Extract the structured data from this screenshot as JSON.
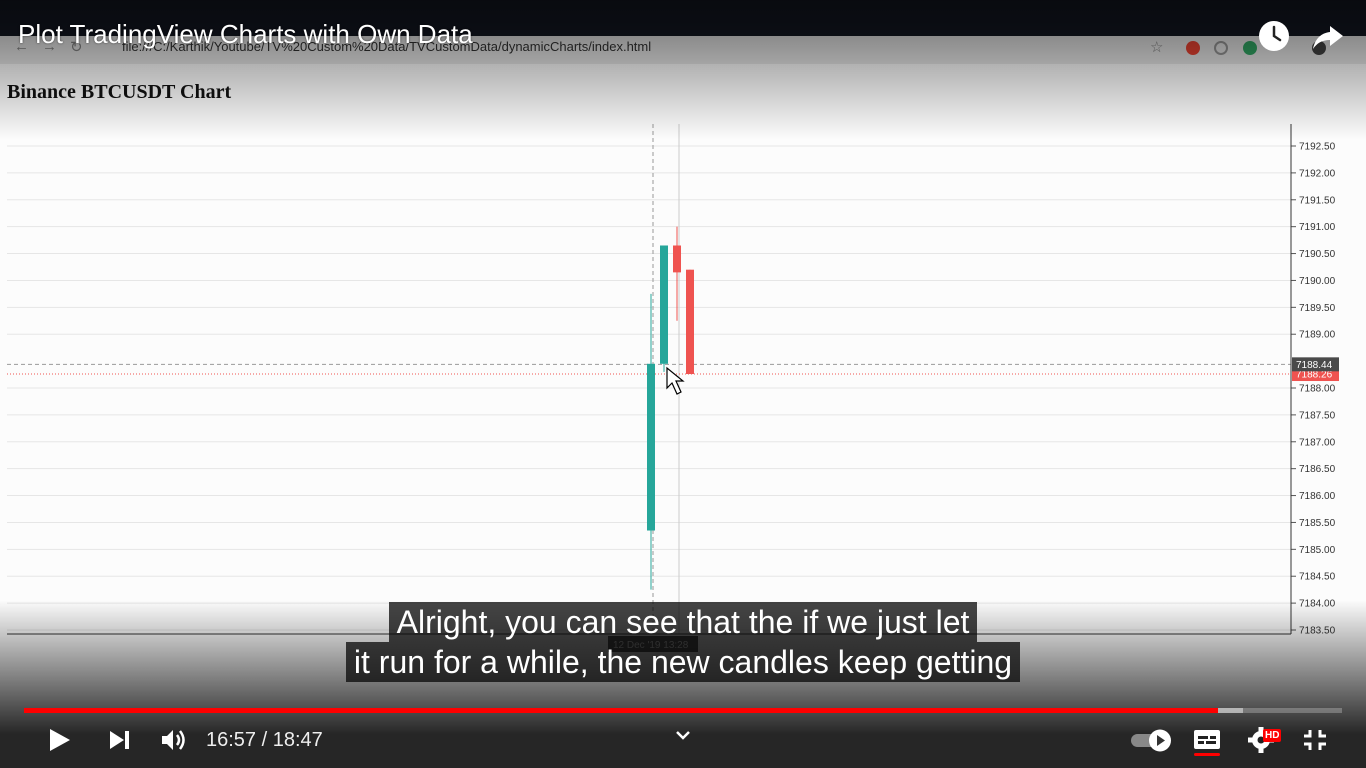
{
  "video": {
    "title": "Plot TradingView Charts with Own Data",
    "captions": [
      "Alright, you can see that the if we just let",
      "it run for a while, the new candles keep getting"
    ],
    "time_current": "16:57",
    "time_separator": " / ",
    "time_total": "18:47",
    "progress": 0.906,
    "buffered": 0.925,
    "accent_color": "#ff0000",
    "icons": {
      "watch_later": "clock-icon",
      "share": "share-arrow-icon",
      "play": "play-icon",
      "next": "next-icon",
      "volume": "volume-icon",
      "expand": "chevron-down-icon",
      "autoplay": "autoplay-toggle-icon",
      "captions": "subtitles-icon",
      "settings": "gear-icon",
      "fullscreen_exit": "exit-fullscreen-icon"
    },
    "hd_badge": "HD"
  },
  "browser": {
    "url": "file:///C:/Karthik/Youtube/TV%20Custom%20Data/TVCustomData/dynamicCharts/index.html",
    "extensions": [
      "star-icon",
      "adblock-icon",
      "extension-icon",
      "extension-icon",
      "profile-icon"
    ]
  },
  "page": {
    "heading": "Binance BTCUSDT Chart"
  },
  "chart_data": {
    "type": "candlestick",
    "title": "Binance BTCUSDT Chart",
    "y_ticks": [
      "7192.50",
      "7192.00",
      "7191.50",
      "7191.00",
      "7190.50",
      "7190.00",
      "7189.50",
      "7189.00",
      "7188.44",
      "7188.26",
      "7188.00",
      "7187.50",
      "7187.00",
      "7186.50",
      "7186.00",
      "7185.50",
      "7185.00",
      "7184.50",
      "7184.00",
      "7183.50"
    ],
    "ylim": [
      7183.5,
      7192.5
    ],
    "last_price": 7188.26,
    "crosshair_price": 7188.44,
    "time_label": "12 Dec '19   13:28",
    "candles": [
      {
        "open": 7185.35,
        "high": 7189.75,
        "low": 7184.25,
        "close": 7188.45,
        "color": "#26a69a"
      },
      {
        "open": 7188.45,
        "high": 7190.65,
        "low": 7188.3,
        "close": 7190.65,
        "color": "#26a69a"
      },
      {
        "open": 7190.65,
        "high": 7191.0,
        "low": 7189.25,
        "close": 7190.15,
        "color": "#ef5350"
      },
      {
        "open": 7190.2,
        "high": 7190.2,
        "low": 7188.26,
        "close": 7188.26,
        "color": "#ef5350"
      }
    ],
    "up_color": "#26a69a",
    "down_color": "#ef5350",
    "grid": true
  }
}
